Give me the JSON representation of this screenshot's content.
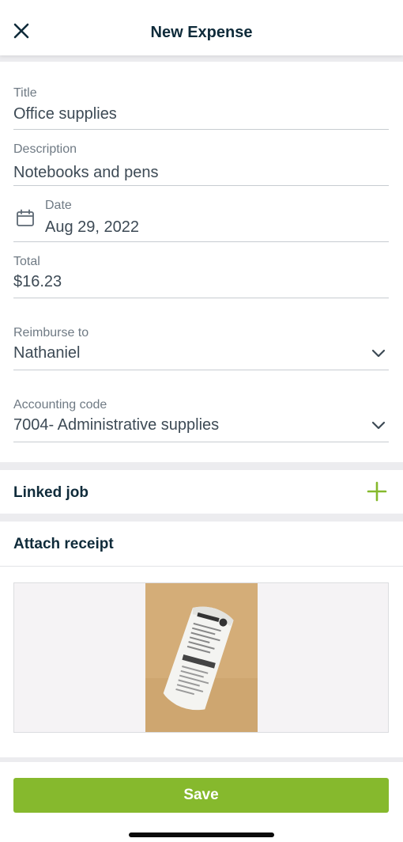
{
  "header": {
    "title": "New Expense",
    "close_icon": "close-icon"
  },
  "form": {
    "title": {
      "label": "Title",
      "value": "Office supplies"
    },
    "description": {
      "label": "Description",
      "value": "Notebooks and pens"
    },
    "date": {
      "label": "Date",
      "value": "Aug 29, 2022",
      "icon": "calendar-icon"
    },
    "total": {
      "label": "Total",
      "value": "$16.23"
    },
    "reimburse_to": {
      "label": "Reimburse to",
      "value": "Nathaniel",
      "icon": "chevron-down-icon"
    },
    "accounting_code": {
      "label": "Accounting code",
      "value": "7004- Administrative supplies",
      "icon": "chevron-down-icon"
    }
  },
  "linked_job": {
    "title": "Linked job",
    "icon": "plus-icon"
  },
  "attach_receipt": {
    "title": "Attach receipt",
    "image": "receipt-photo"
  },
  "footer": {
    "save_label": "Save"
  },
  "colors": {
    "accent": "#86b92d",
    "heading": "#0f2b3a",
    "label": "#6f7a84",
    "text": "#3d4a55"
  }
}
